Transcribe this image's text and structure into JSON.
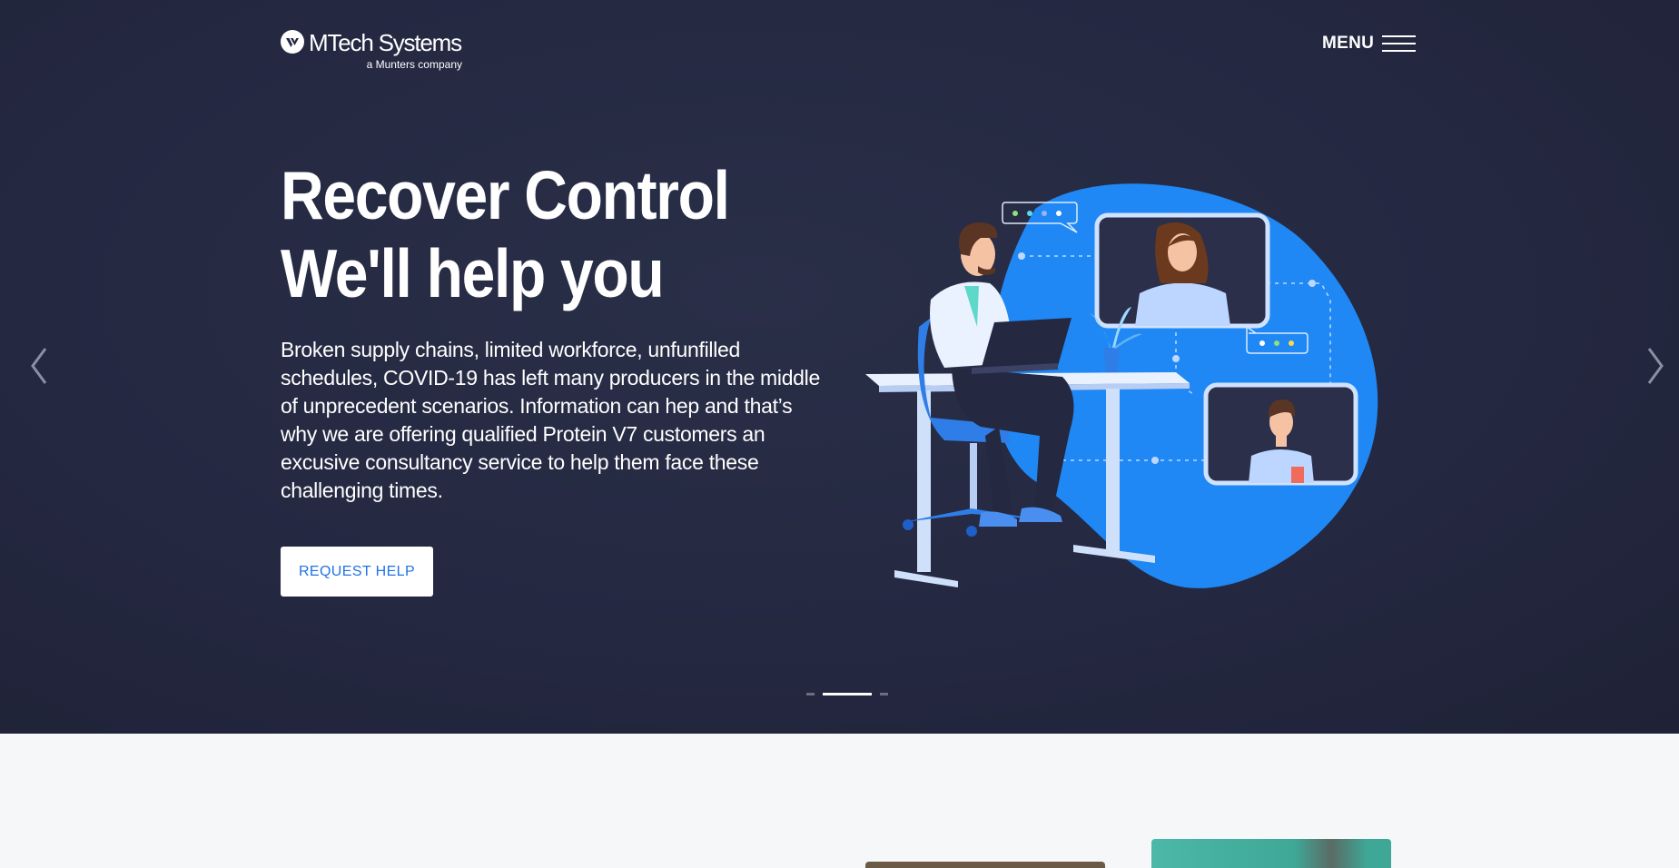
{
  "header": {
    "logo_name": "MTech Systems",
    "logo_sub": "a Munters company",
    "menu_label": "MENU"
  },
  "hero": {
    "headline_line1": "Recover Control",
    "headline_line2": "We'll help you",
    "body": "Broken supply chains, limited workforce, unfunfilled schedules, COVID-19 has left many producers in the middle of unprecedent scenarios. Information can hep and that’s why we are offering qualified Protein V7 customers an excusive consultancy service to help them face these challenging times.",
    "cta_label": "REQUEST HELP",
    "slides_total": 3,
    "active_slide": 2
  },
  "icons": {
    "prev": "chevron-left-icon",
    "next": "chevron-right-icon",
    "menu": "hamburger-icon"
  },
  "colors": {
    "hero_bg": "#242841",
    "accent_blue": "#1f88f5",
    "cta_text": "#1f72e8",
    "page_bg": "#f6f7f9"
  }
}
